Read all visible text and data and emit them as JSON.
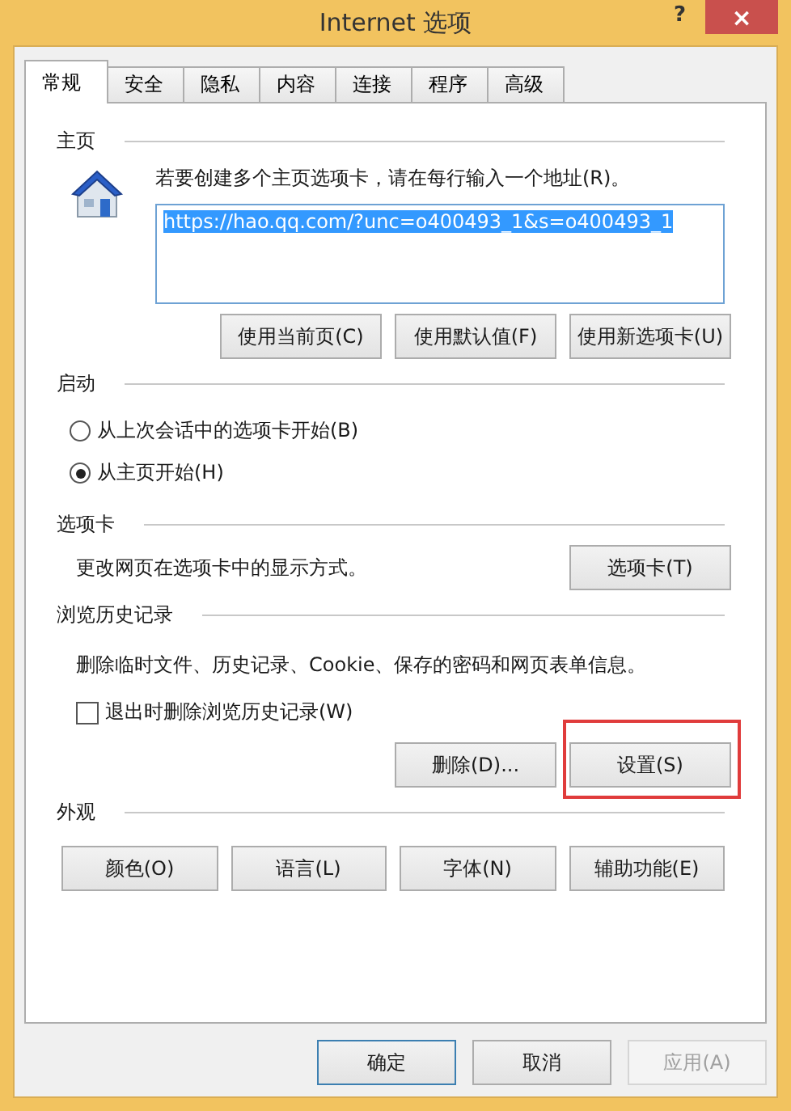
{
  "window": {
    "title": "Internet 选项",
    "help_button": "?",
    "close_button": "×"
  },
  "tabs": [
    {
      "label": "常规",
      "selected": true
    },
    {
      "label": "安全",
      "selected": false
    },
    {
      "label": "隐私",
      "selected": false
    },
    {
      "label": "内容",
      "selected": false
    },
    {
      "label": "连接",
      "selected": false
    },
    {
      "label": "程序",
      "selected": false
    },
    {
      "label": "高级",
      "selected": false
    }
  ],
  "home_page": {
    "heading": "主页",
    "instruction": "若要创建多个主页选项卡，请在每行输入一个地址(R)。",
    "addresses": {
      "value": "https://hao.qq.com/?unc=o400493_1&s=o400493_1",
      "selected": true
    },
    "buttons": [
      "使用当前页(C)",
      "使用默认值(F)",
      "使用新选项卡(U)"
    ]
  },
  "startup": {
    "heading": "启动",
    "options": [
      {
        "label": "从上次会话中的选项卡开始(B)",
        "selected": false
      },
      {
        "label": "从主页开始(H)",
        "selected": true
      }
    ]
  },
  "tabs_section": {
    "heading": "选项卡",
    "description": "更改网页在选项卡中的显示方式。",
    "button": "选项卡(T)"
  },
  "browsing_history": {
    "heading": "浏览历史记录",
    "description": "删除临时文件、历史记录、Cookie、保存的密码和网页表单信息。",
    "delete_on_exit": {
      "label": "退出时删除浏览历史记录(W)",
      "checked": false
    },
    "buttons": [
      {
        "label": "删除(D)...",
        "highlighted": false
      },
      {
        "label": "设置(S)",
        "highlighted": true
      }
    ]
  },
  "appearance": {
    "heading": "外观",
    "buttons": [
      "颜色(O)",
      "语言(L)",
      "字体(N)",
      "辅助功能(E)"
    ]
  },
  "dialog_buttons": [
    {
      "label": "确定",
      "default": true,
      "disabled": false
    },
    {
      "label": "取消",
      "default": false,
      "disabled": false
    },
    {
      "label": "应用(A)",
      "default": false,
      "disabled": true
    }
  ]
}
